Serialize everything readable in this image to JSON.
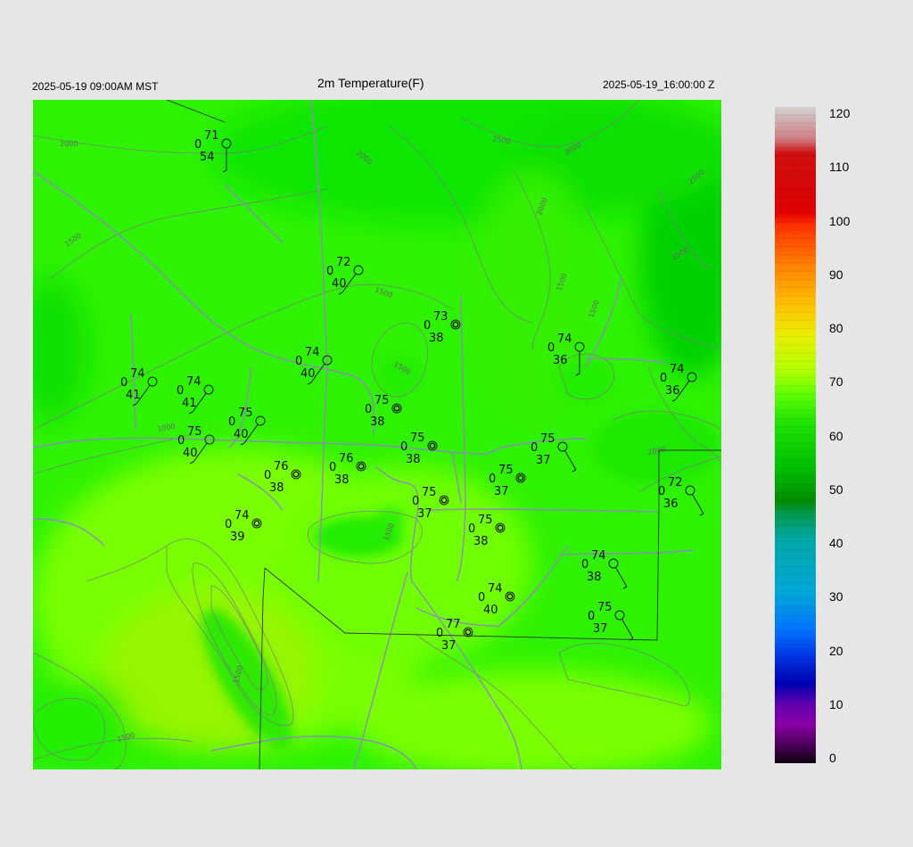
{
  "header": {
    "left": "2025-05-19 09:00AM MST",
    "title": "2m Temperature(F)",
    "right": "2025-05-19_16:00:00 Z"
  },
  "contour_labels": [
    "2000",
    "1500",
    "1000",
    "2000",
    "2500",
    "3000",
    "2500",
    "2000",
    "1500",
    "2500",
    "1500",
    "2000",
    "1500",
    "1500",
    "1500",
    "1500",
    "1500"
  ],
  "stations": [
    {
      "temp": "71",
      "wind": "0",
      "dew": "54",
      "symbol": "single"
    },
    {
      "temp": "72",
      "wind": "0",
      "dew": "40",
      "symbol": "single"
    },
    {
      "temp": "73",
      "wind": "0",
      "dew": "38",
      "symbol": "double"
    },
    {
      "temp": "74",
      "wind": "0",
      "dew": "40",
      "symbol": "single"
    },
    {
      "temp": "74",
      "wind": "0",
      "dew": "41",
      "symbol": "single"
    },
    {
      "temp": "74",
      "wind": "0",
      "dew": "41",
      "symbol": "single"
    },
    {
      "temp": "75",
      "wind": "0",
      "dew": "40",
      "symbol": "single"
    },
    {
      "temp": "75",
      "wind": "0",
      "dew": "40",
      "symbol": "single"
    },
    {
      "temp": "75",
      "wind": "0",
      "dew": "38",
      "symbol": "double"
    },
    {
      "temp": "75",
      "wind": "0",
      "dew": "38",
      "symbol": "double"
    },
    {
      "temp": "76",
      "wind": "0",
      "dew": "38",
      "symbol": "double"
    },
    {
      "temp": "76",
      "wind": "0",
      "dew": "38",
      "symbol": "double"
    },
    {
      "temp": "74",
      "wind": "0",
      "dew": "39",
      "symbol": "double"
    },
    {
      "temp": "75",
      "wind": "0",
      "dew": "37",
      "symbol": "double"
    },
    {
      "temp": "75",
      "wind": "0",
      "dew": "37",
      "symbol": "double"
    },
    {
      "temp": "75",
      "wind": "0",
      "dew": "38",
      "symbol": "double"
    },
    {
      "temp": "75",
      "wind": "0",
      "dew": "37",
      "symbol": "single"
    },
    {
      "temp": "74",
      "wind": "0",
      "dew": "36",
      "symbol": "single"
    },
    {
      "temp": "74",
      "wind": "0",
      "dew": "36",
      "symbol": "single"
    },
    {
      "temp": "72",
      "wind": "0",
      "dew": "36",
      "symbol": "single"
    },
    {
      "temp": "74",
      "wind": "0",
      "dew": "38",
      "symbol": "single"
    },
    {
      "temp": "74",
      "wind": "0",
      "dew": "40",
      "symbol": "double"
    },
    {
      "temp": "75",
      "wind": "0",
      "dew": "37",
      "symbol": "single"
    },
    {
      "temp": "77",
      "wind": "0",
      "dew": "37",
      "symbol": "double"
    }
  ],
  "colorbar": {
    "labels": [
      "120",
      "110",
      "100",
      "90",
      "80",
      "70",
      "60",
      "50",
      "40",
      "30",
      "20",
      "10",
      "0"
    ],
    "colors": {
      "magenta": "#8a00a8",
      "blue": "#0010c8",
      "cyan": "#00a8a8",
      "green": "#00d000",
      "lime": "#40ff00",
      "yellow": "#ffd800",
      "orange": "#ff8000",
      "red": "#e00000",
      "gray": "#cccccc"
    }
  }
}
